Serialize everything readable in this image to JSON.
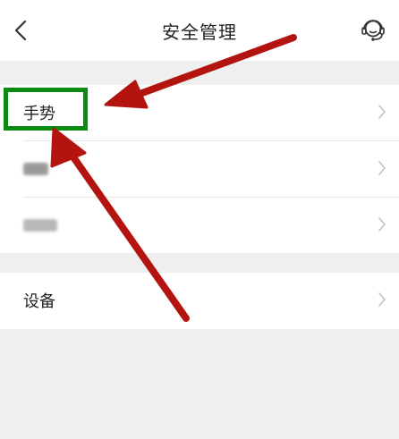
{
  "header": {
    "title": "安全管理",
    "back_icon": "chevron-left-icon",
    "support_icon": "headset-icon"
  },
  "section1": {
    "items": [
      {
        "label": "手势",
        "blurred": false
      },
      {
        "label": "",
        "blurred": true
      },
      {
        "label": "",
        "blurred": true
      }
    ]
  },
  "section2": {
    "items": [
      {
        "label": "设备"
      }
    ]
  },
  "colors": {
    "header_bg": "#ffffff",
    "page_bg": "#efefef",
    "highlight": "#0a8a13",
    "arrow": "#b3140f",
    "text": "#222222",
    "chevron": "#c2c2c2"
  }
}
